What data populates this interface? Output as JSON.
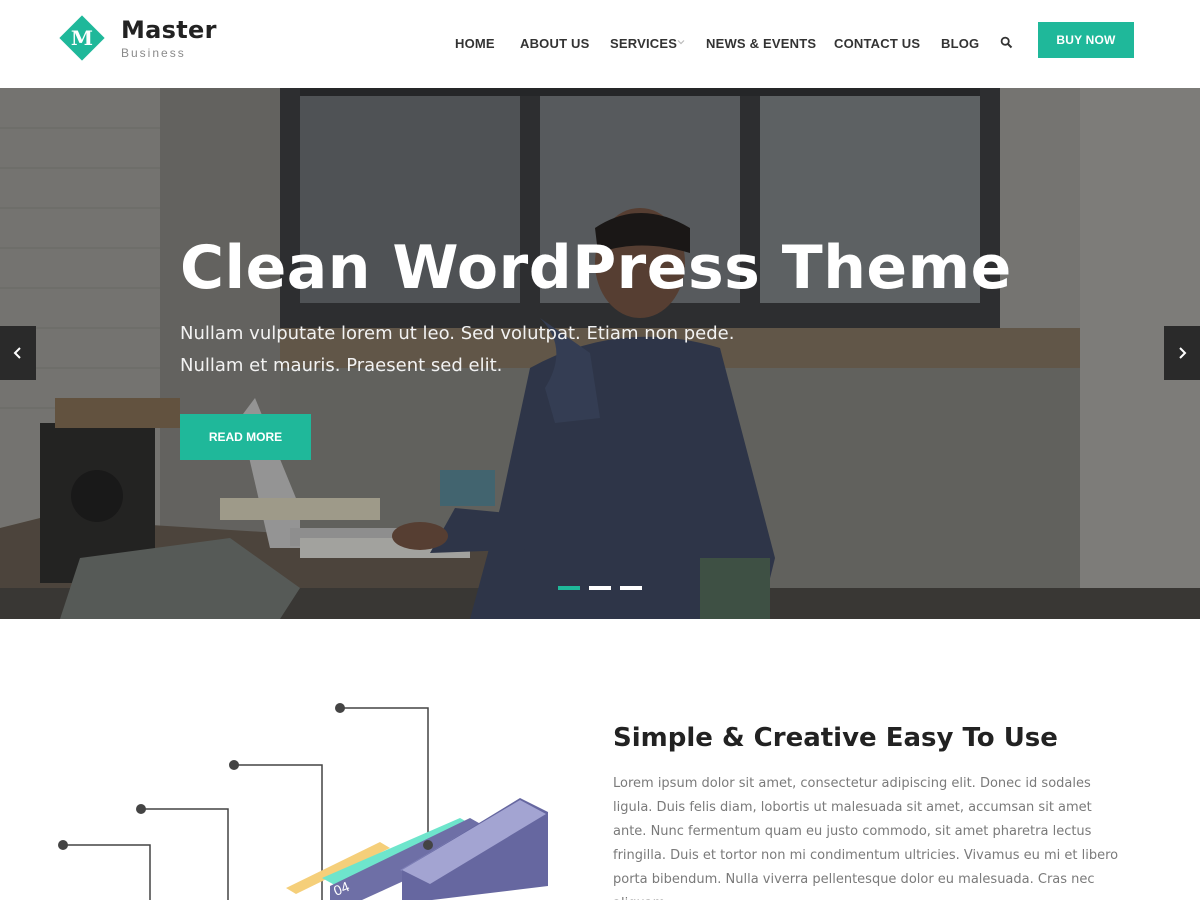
{
  "brand": {
    "title": "Master",
    "subtitle": "Business",
    "letter": "M",
    "accent": "#1fb89a"
  },
  "nav": {
    "items": [
      {
        "label": "HOME"
      },
      {
        "label": "ABOUT US"
      },
      {
        "label": "SERVICES",
        "has_dropdown": true
      },
      {
        "label": "NEWS & EVENTS"
      },
      {
        "label": "CONTACT US"
      },
      {
        "label": "BLOG"
      }
    ],
    "search_icon": "search-icon",
    "buy_label": "BUY NOW"
  },
  "hero": {
    "title": "Clean WordPress Theme",
    "text": "Nullam vulputate lorem ut leo. Sed volutpat. Etiam non pede. Nullam et mauris. Praesent sed elit.",
    "button_label": "READ MORE",
    "prev_icon": "chevron-left-icon",
    "next_icon": "chevron-right-icon",
    "slides_count": 3,
    "active_slide": 1
  },
  "feature": {
    "title": "Simple & Creative Easy To Use",
    "text": "Lorem ipsum dolor sit amet, consectetur adipiscing elit. Donec id sodales ligula. Duis felis diam, lobortis ut malesuada sit amet, accumsan sit amet ante. Nunc fermentum quam eu justo commodo, sit amet pharetra lectus fringilla. Duis et tortor non mi condimentum ultricies. Vivamus eu mi et libero porta bibendum. Nulla viverra pellentesque dolor eu malesuada. Cras nec aliquam",
    "illustration_label": "04"
  }
}
